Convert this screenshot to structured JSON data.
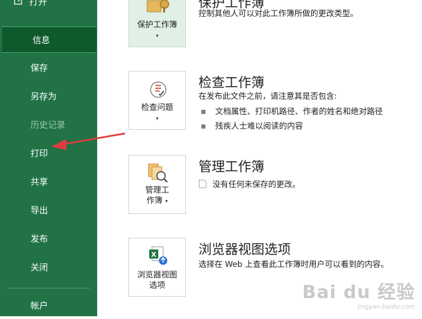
{
  "sidebar": {
    "top_item": "打开",
    "items": [
      {
        "label": "信息"
      },
      {
        "label": "保存"
      },
      {
        "label": "另存为"
      },
      {
        "label": "历史记录"
      },
      {
        "label": "打印"
      },
      {
        "label": "共享"
      },
      {
        "label": "导出"
      },
      {
        "label": "发布"
      },
      {
        "label": "关闭"
      },
      {
        "label": "帐户"
      }
    ],
    "selected": "信息",
    "disabled": [
      "历史记录"
    ],
    "accent_color": "#217346"
  },
  "sections": {
    "protect": {
      "title": "保护工作簿",
      "button_label": "保护工作簿",
      "description": "控制其他人可以对此工作簿所做的更改类型。"
    },
    "inspect": {
      "title": "检查工作簿",
      "button_label": "检查问题",
      "description": "在发布此文件之前，请注意其是否包含:",
      "bullets": [
        "文档属性、打印机路径、作者的姓名和绝对路径",
        "残疾人士难以阅读的内容"
      ]
    },
    "manage": {
      "title": "管理工作簿",
      "button_label_1": "管理工",
      "button_label_2": "作簿",
      "description": "没有任何未保存的更改。"
    },
    "browser": {
      "title": "浏览器视图选项",
      "button_label_1": "浏览器视图",
      "button_label_2": "选项",
      "description": "选择在 Web 上查看此工作簿时用户可以看到的内容。"
    }
  },
  "watermark": {
    "main": "Bai du 经验",
    "sub": "jingyan.baidu.com"
  }
}
